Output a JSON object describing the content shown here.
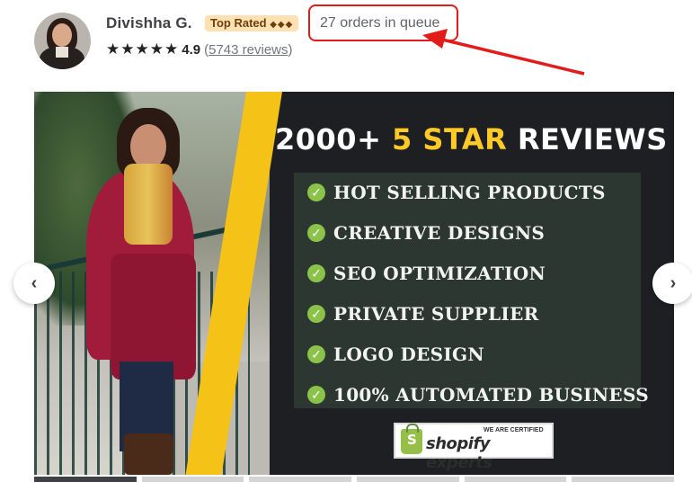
{
  "seller": {
    "name": "Divishha G.",
    "badge": "Top Rated",
    "badge_diamonds": "◆◆◆",
    "stars": [
      "★",
      "★",
      "★",
      "★",
      "★"
    ],
    "rating": "4.9",
    "reviews_open": "(",
    "reviews_text": "5743 reviews",
    "reviews_close": ")",
    "queue": "27 orders in queue"
  },
  "gallery": {
    "headline_prefix": "2000+ ",
    "headline_highlight": "5 STAR",
    "headline_suffix": " REVIEWS",
    "features": [
      "HOT SELLING PRODUCTS",
      "CREATIVE DESIGNS",
      "SEO OPTIMIZATION",
      "PRIVATE SUPPLIER",
      "LOGO DESIGN",
      "100% AUTOMATED BUSINESS"
    ],
    "check_glyph": "✓",
    "certified": "WE ARE CERTIFIED",
    "shopify_s": "S",
    "shopify_brand": "shopify experts",
    "prev_glyph": "‹",
    "next_glyph": "›"
  },
  "colors": {
    "accent_red": "#e21b1b",
    "headline_yellow": "#ffc928",
    "check_green": "#8bc34a"
  }
}
